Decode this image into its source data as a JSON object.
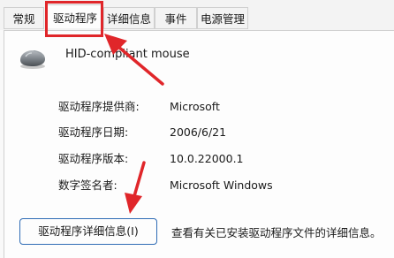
{
  "tabs": [
    {
      "label": "常规",
      "active": false
    },
    {
      "label": "驱动程序",
      "active": true
    },
    {
      "label": "详细信息",
      "active": false
    },
    {
      "label": "事件",
      "active": false
    },
    {
      "label": "电源管理",
      "active": false
    }
  ],
  "device": {
    "icon": "mouse-icon",
    "name": "HID-compliant mouse"
  },
  "properties": [
    {
      "label": "驱动程序提供商:",
      "value": "Microsoft"
    },
    {
      "label": "驱动程序日期:",
      "value": "2006/6/21"
    },
    {
      "label": "驱动程序版本:",
      "value": "10.0.22000.1"
    },
    {
      "label": "数字签名者:",
      "value": "Microsoft Windows"
    }
  ],
  "actions": {
    "details_button_label": "驱动程序详细信息(I)",
    "details_description": "查看有关已安装驱动程序文件的详细信息。"
  },
  "colors": {
    "annotation": "#e0262a",
    "button_border": "#2f6cb5"
  }
}
